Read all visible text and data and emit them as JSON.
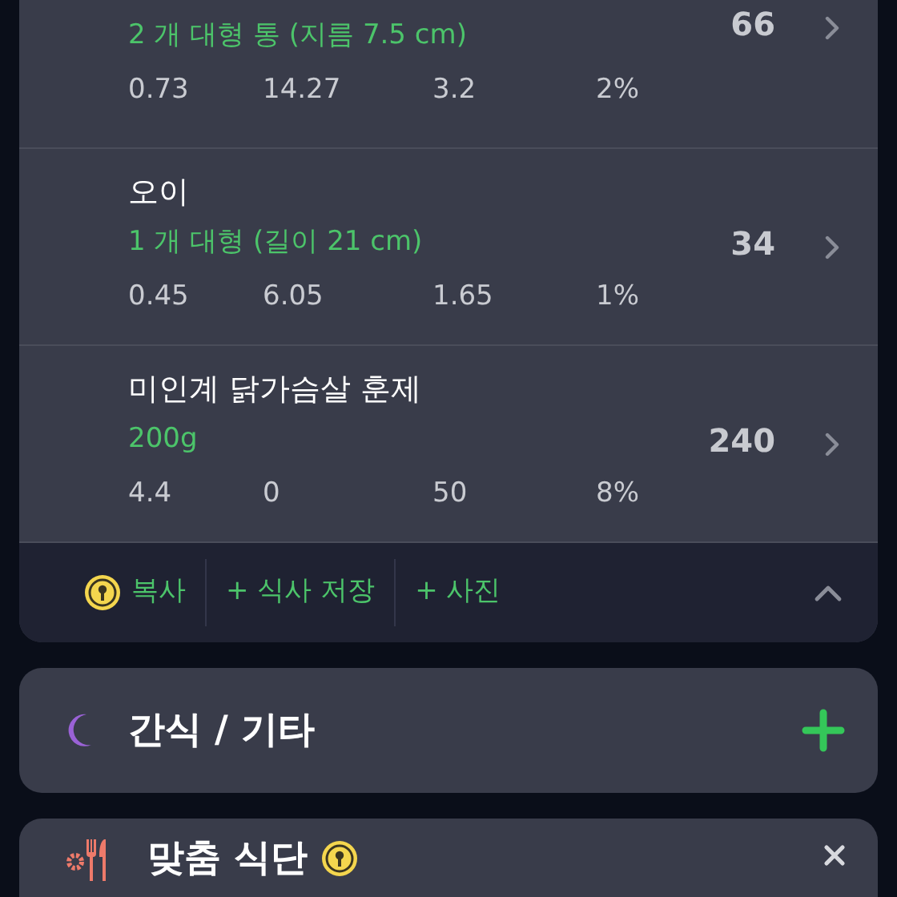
{
  "foods": [
    {
      "portion": "2 개 대형 통 (지름 7.5 cm)",
      "calories": "66",
      "nutrients": [
        "0.73",
        "14.27",
        "3.2",
        "2%"
      ]
    },
    {
      "name": "오이",
      "portion": "1 개 대형 (길이 21 cm)",
      "calories": "34",
      "nutrients": [
        "0.45",
        "6.05",
        "1.65",
        "1%"
      ]
    },
    {
      "name": "미인계 닭가슴살 훈제",
      "portion": "200g",
      "calories": "240",
      "nutrients": [
        "4.4",
        "0",
        "50",
        "8%"
      ]
    }
  ],
  "actions": [
    {
      "label": "복사",
      "locked": true
    },
    {
      "label": "식사 저장",
      "locked": false,
      "prefix": "+"
    },
    {
      "label": "사진",
      "locked": false,
      "prefix": "+"
    }
  ],
  "sections": [
    {
      "title": "간식 / 기타",
      "kind": "snack",
      "locked": false
    },
    {
      "title": "맞춤 식단",
      "kind": "custom",
      "locked": true
    }
  ]
}
